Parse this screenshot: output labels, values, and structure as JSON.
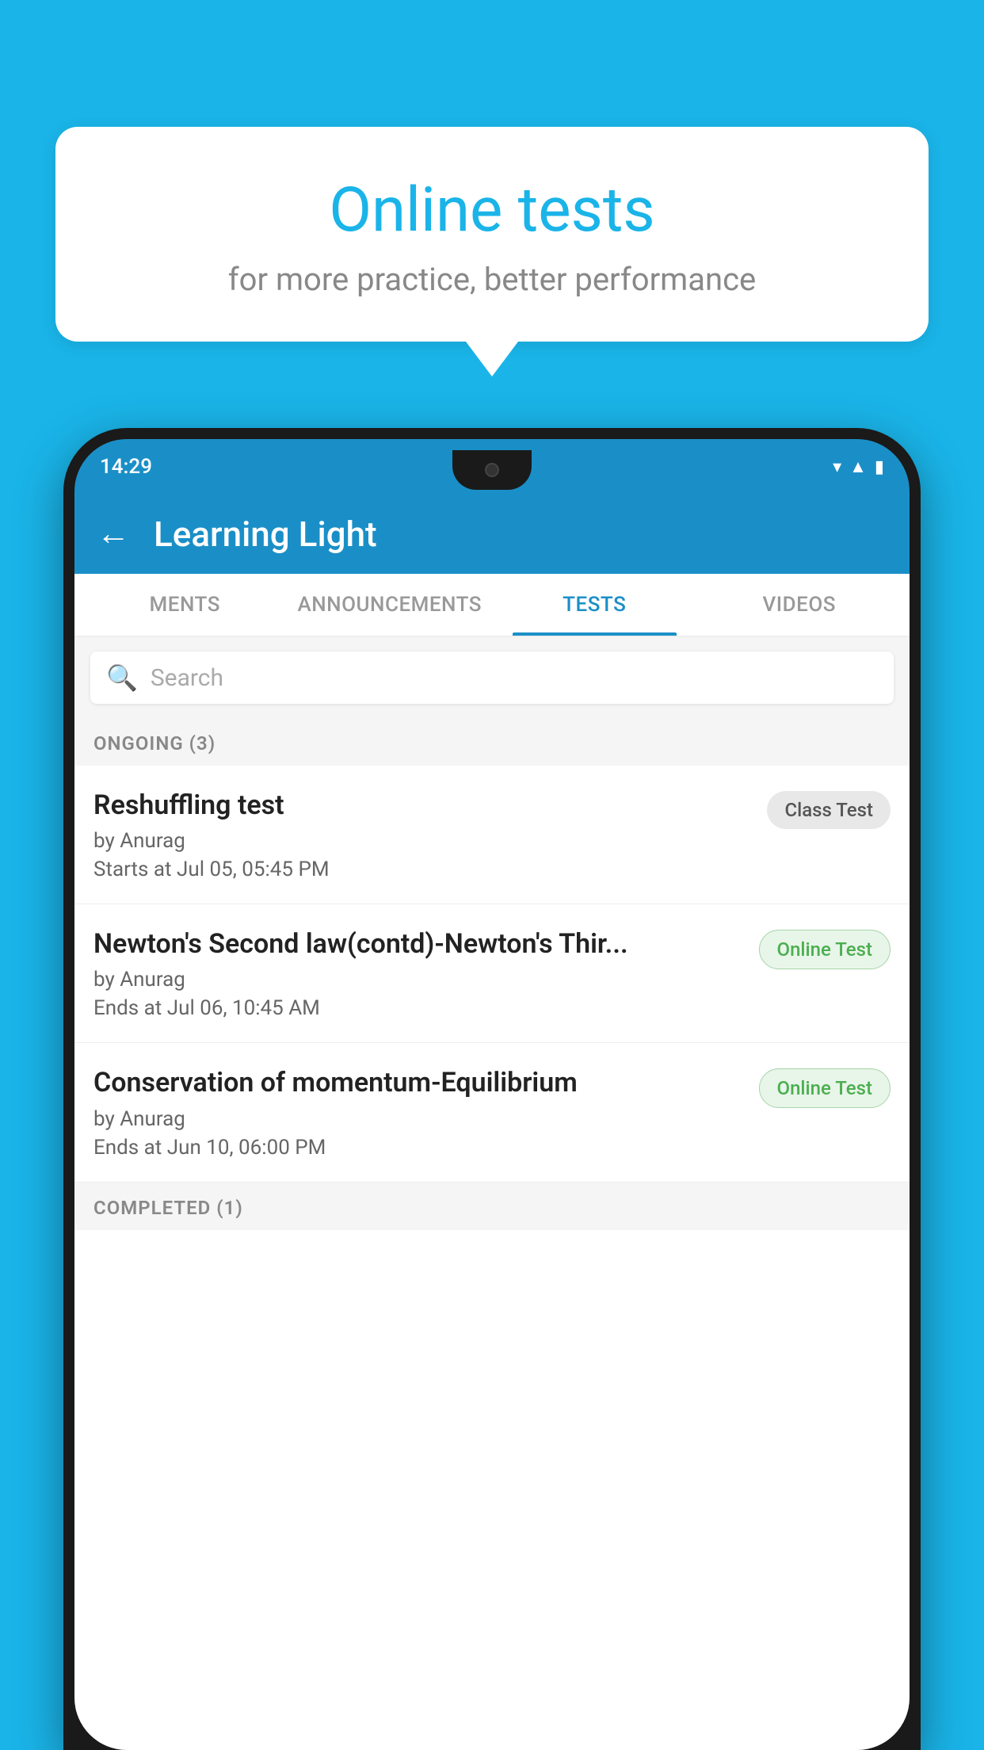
{
  "background_color": "#1ab4e8",
  "bubble": {
    "title": "Online tests",
    "subtitle": "for more practice, better performance"
  },
  "phone": {
    "time": "14:29",
    "status_icons": [
      "wifi",
      "signal",
      "battery"
    ]
  },
  "app": {
    "title": "Learning Light",
    "back_label": "←"
  },
  "tabs": [
    {
      "label": "MENTS",
      "active": false
    },
    {
      "label": "ANNOUNCEMENTS",
      "active": false
    },
    {
      "label": "TESTS",
      "active": true
    },
    {
      "label": "VIDEOS",
      "active": false
    }
  ],
  "search": {
    "placeholder": "Search",
    "icon": "🔍"
  },
  "section_ongoing": {
    "label": "ONGOING (3)"
  },
  "tests": [
    {
      "name": "Reshuffling test",
      "author": "by Anurag",
      "date_label": "Starts at",
      "date": "Jul 05, 05:45 PM",
      "badge": "Class Test",
      "badge_type": "class"
    },
    {
      "name": "Newton's Second law(contd)-Newton's Thir...",
      "author": "by Anurag",
      "date_label": "Ends at",
      "date": "Jul 06, 10:45 AM",
      "badge": "Online Test",
      "badge_type": "online"
    },
    {
      "name": "Conservation of momentum-Equilibrium",
      "author": "by Anurag",
      "date_label": "Ends at",
      "date": "Jun 10, 06:00 PM",
      "badge": "Online Test",
      "badge_type": "online"
    }
  ],
  "section_completed": {
    "label": "COMPLETED (1)"
  }
}
